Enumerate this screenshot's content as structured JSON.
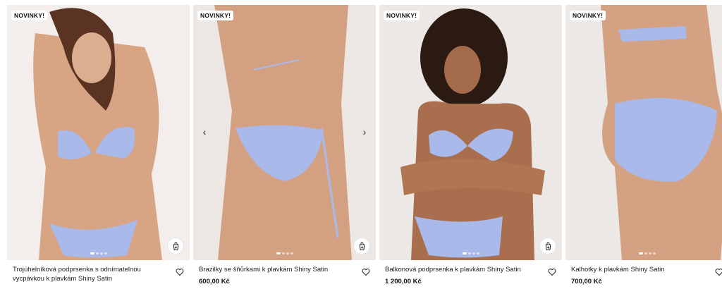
{
  "products": [
    {
      "badge": "NOVINKY!",
      "name": "Trojúhelníková podprsenka s odnímatelnou vycpávkou k plavkám Shiny Satin",
      "price": "",
      "icons": {
        "cart": "add-to-cart-icon",
        "wish": "heart-icon"
      }
    },
    {
      "badge": "NOVINKY!",
      "name": "Brazilky se šňůrkami k plavkám Shiny Satin",
      "price": "600,00 Kč",
      "arrows": {
        "prev": "‹",
        "next": "›"
      },
      "icons": {
        "cart": "add-to-cart-icon",
        "wish": "heart-icon"
      }
    },
    {
      "badge": "NOVINKY!",
      "name": "Balkonová podprsenka k plavkám Shiny Satin",
      "price": "1 200,00 Kč",
      "icons": {
        "cart": "add-to-cart-icon",
        "wish": "heart-icon"
      }
    },
    {
      "badge": "NOVINKY!",
      "name": "Kalhotky k plavkám Shiny Satin",
      "price": "700,00 Kč",
      "icons": {
        "wish": "heart-icon"
      }
    }
  ],
  "colors": {
    "satin": "#a9b9ea",
    "skin": "#d9a988",
    "background": "#ece8e5"
  }
}
